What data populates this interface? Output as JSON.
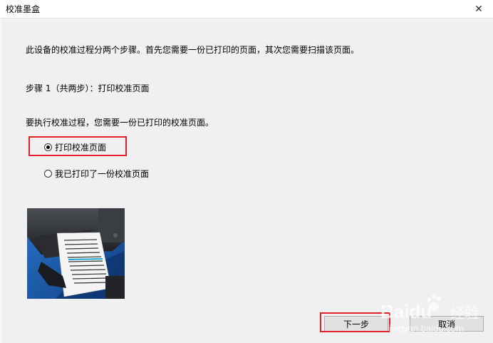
{
  "window": {
    "title": "校准墨盒",
    "close_glyph": "✕"
  },
  "intro_text": "此设备的校准过程分两个步骤。首先您需要一份已打印的页面，其次您需要扫描该页面。",
  "step_text": "步骤 1（共两步）：打印校准页面",
  "instruction_text": "要执行校准过程，您需要一份已打印的校准页面。",
  "options": [
    {
      "label": "打印校准页面",
      "selected": true
    },
    {
      "label": "我已打印了一份校准页面",
      "selected": false
    }
  ],
  "illustration": {
    "icon": "printer-printing-page-illustration"
  },
  "buttons": {
    "next_label": "下一步",
    "cancel_label": "取消"
  },
  "watermark": {
    "brand": "Baidu",
    "brand_cn": "经验",
    "url": "jingyan.baidu.com"
  },
  "colors": {
    "highlight": "#e0202a",
    "background": "#f0f0f0",
    "illustration_bg": "#1d5fb0"
  }
}
